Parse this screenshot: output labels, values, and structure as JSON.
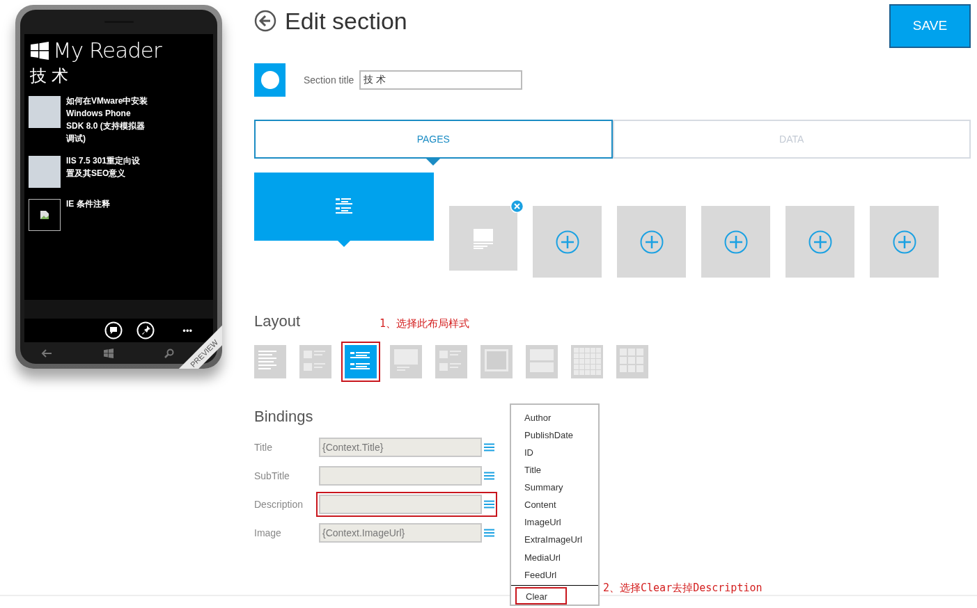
{
  "phone": {
    "app_title": "My Reader",
    "section_title": "技 术",
    "articles": [
      {
        "title": "如何在VMware中安装Windows Phone SDK 8.0 (支持模拟器调试)",
        "kind": "photo"
      },
      {
        "title": "IIS 7.5 301重定向设置及其SEO意义",
        "kind": "photo"
      },
      {
        "title": "IE 条件注释",
        "kind": "broken"
      }
    ],
    "more": "•••",
    "ribbon": "PREVIEW"
  },
  "header": {
    "title": "Edit section",
    "save": "SAVE"
  },
  "section_title": {
    "label": "Section title",
    "value": "技 术"
  },
  "tabs": [
    {
      "label": "PAGES",
      "selected": true
    },
    {
      "label": "DATA",
      "selected": false
    }
  ],
  "pages": [
    {
      "kind": "page",
      "selected": true
    },
    {
      "kind": "page",
      "selected": false,
      "removable": true
    },
    {
      "kind": "add"
    },
    {
      "kind": "add"
    },
    {
      "kind": "add"
    },
    {
      "kind": "add"
    },
    {
      "kind": "add"
    }
  ],
  "layout": {
    "heading": "Layout",
    "note": "1、选择此布局样式",
    "options": [
      {
        "kind": "lines",
        "selected": false,
        "annotated": false
      },
      {
        "kind": "thumb-list",
        "selected": false,
        "annotated": false
      },
      {
        "kind": "lines",
        "selected": true,
        "annotated": true
      },
      {
        "kind": "image-caption",
        "selected": false,
        "annotated": false
      },
      {
        "kind": "thumb-list",
        "selected": false,
        "annotated": false
      },
      {
        "kind": "image",
        "selected": false,
        "annotated": false
      },
      {
        "kind": "banner",
        "selected": false,
        "annotated": false
      },
      {
        "kind": "grid-small",
        "selected": false,
        "annotated": false
      },
      {
        "kind": "grid-large",
        "selected": false,
        "annotated": false
      }
    ]
  },
  "bindings": {
    "heading": "Bindings",
    "rows": [
      {
        "label": "Title",
        "value": "{Context.Title}",
        "annotated": false
      },
      {
        "label": "SubTitle",
        "value": "",
        "annotated": false
      },
      {
        "label": "Description",
        "value": "",
        "annotated": true
      },
      {
        "label": "Image",
        "value": "{Context.ImageUrl}",
        "annotated": false
      }
    ]
  },
  "menu": {
    "items": [
      {
        "label": "Author",
        "annotated": false
      },
      {
        "label": "PublishDate",
        "annotated": false
      },
      {
        "label": "ID",
        "annotated": false
      },
      {
        "label": "Title",
        "annotated": false
      },
      {
        "label": "Summary",
        "annotated": false
      },
      {
        "label": "Content",
        "annotated": false
      },
      {
        "label": "ImageUrl",
        "annotated": false
      },
      {
        "label": "ExtraImageUrl",
        "annotated": false
      },
      {
        "label": "MediaUrl",
        "annotated": false
      },
      {
        "label": "FeedUrl",
        "annotated": false
      },
      {
        "label": "Clear",
        "annotated": true
      }
    ],
    "note": "2、选择Clear去掉Description"
  }
}
